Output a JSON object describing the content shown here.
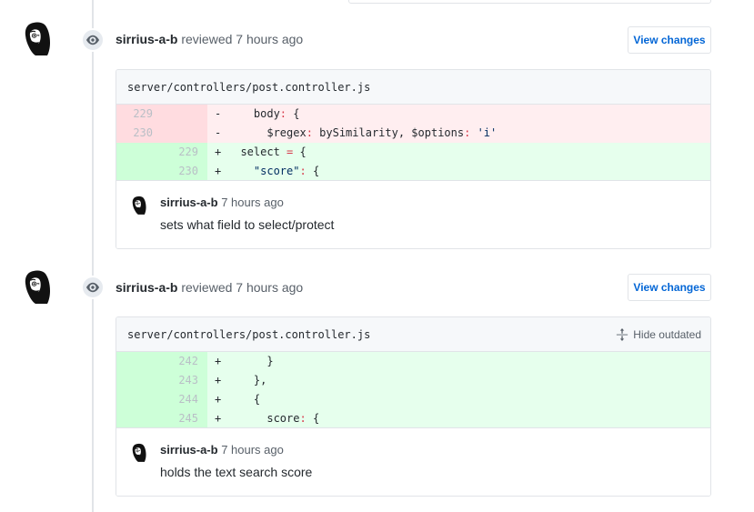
{
  "timeline": {
    "reviews": [
      {
        "avatar_name": "avatar-sirrius-a-b",
        "event_icon": "eye-icon",
        "author": "sirrius-a-b",
        "action_text": " reviewed 7 hours ago",
        "view_changes_label": "View changes",
        "diff": {
          "filename": "server/controllers/post.controller.js",
          "has_hide_outdated": false,
          "hide_outdated_label": "",
          "rows": [
            {
              "type": "del",
              "old_line": "229",
              "new_line": "",
              "marker": "-",
              "code": "    body: {"
            },
            {
              "type": "del",
              "old_line": "230",
              "new_line": "",
              "marker": "-",
              "code": "      $regex: bySimilarity, $options: 'i'"
            },
            {
              "type": "add",
              "old_line": "",
              "new_line": "229",
              "marker": "+",
              "code": "  select = {"
            },
            {
              "type": "add",
              "old_line": "",
              "new_line": "230",
              "marker": "+",
              "code": "    \"score\": {"
            }
          ]
        },
        "comment": {
          "author": "sirrius-a-b",
          "timestamp": " 7 hours ago",
          "text": "sets what field to select/protect"
        }
      },
      {
        "avatar_name": "avatar-sirrius-a-b",
        "event_icon": "eye-icon",
        "author": "sirrius-a-b",
        "action_text": " reviewed 7 hours ago",
        "view_changes_label": "View changes",
        "diff": {
          "filename": "server/controllers/post.controller.js",
          "has_hide_outdated": true,
          "hide_outdated_label": "Hide outdated",
          "rows": [
            {
              "type": "add",
              "old_line": "",
              "new_line": "242",
              "marker": "+",
              "code": "      }"
            },
            {
              "type": "add",
              "old_line": "",
              "new_line": "243",
              "marker": "+",
              "code": "    },"
            },
            {
              "type": "add",
              "old_line": "",
              "new_line": "244",
              "marker": "+",
              "code": "    {"
            },
            {
              "type": "add",
              "old_line": "",
              "new_line": "245",
              "marker": "+",
              "code": "      score: {"
            }
          ]
        },
        "comment": {
          "author": "sirrius-a-b",
          "timestamp": " 7 hours ago",
          "text": "holds the text search score"
        }
      }
    ]
  },
  "colors": {
    "link_blue": "#0366d6",
    "diff_add_bg": "#e6ffed",
    "diff_add_gutter": "#cdffd8",
    "diff_del_bg": "#ffeef0",
    "diff_del_gutter": "#ffdce0",
    "border": "#e1e4e8",
    "muted_text": "#586069",
    "header_bg": "#f6f8fa"
  }
}
